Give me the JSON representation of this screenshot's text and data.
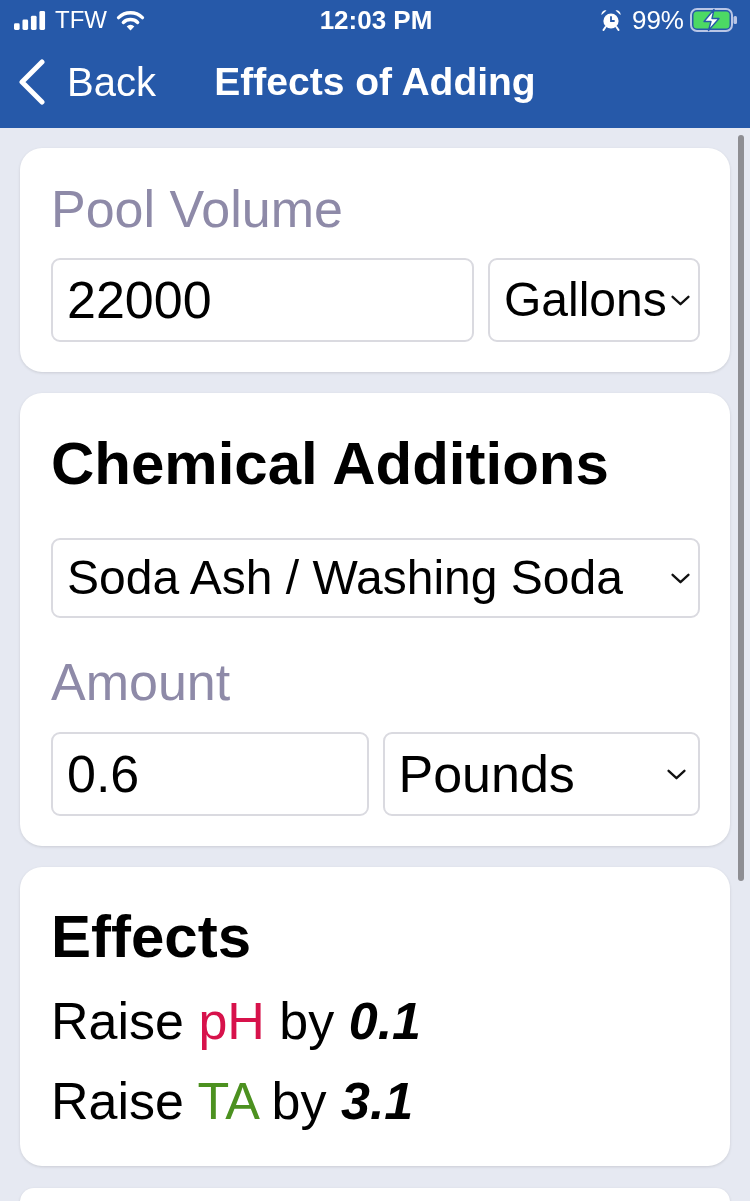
{
  "status_bar": {
    "carrier": "TFW",
    "time": "12:03 PM",
    "battery": "99%",
    "charging": true
  },
  "nav_bar": {
    "back": "Back",
    "title": "Effects of Adding"
  },
  "pool_volume": {
    "label": "Pool Volume",
    "value": "22000",
    "unit": "Gallons"
  },
  "chemical_additions": {
    "title": "Chemical Additions",
    "chemical": "Soda Ash / Washing Soda",
    "amount_label": "Amount",
    "amount": "0.6",
    "unit": "Pounds"
  },
  "effects": {
    "title": "Effects",
    "items": [
      {
        "verb": "Raise",
        "parameter": "pH",
        "color": "#d7124b",
        "preposition": "by",
        "amount": "0.1"
      },
      {
        "verb": "Raise",
        "parameter": "TA",
        "color": "#4c9120",
        "preposition": "by",
        "amount": "3.1"
      }
    ]
  }
}
